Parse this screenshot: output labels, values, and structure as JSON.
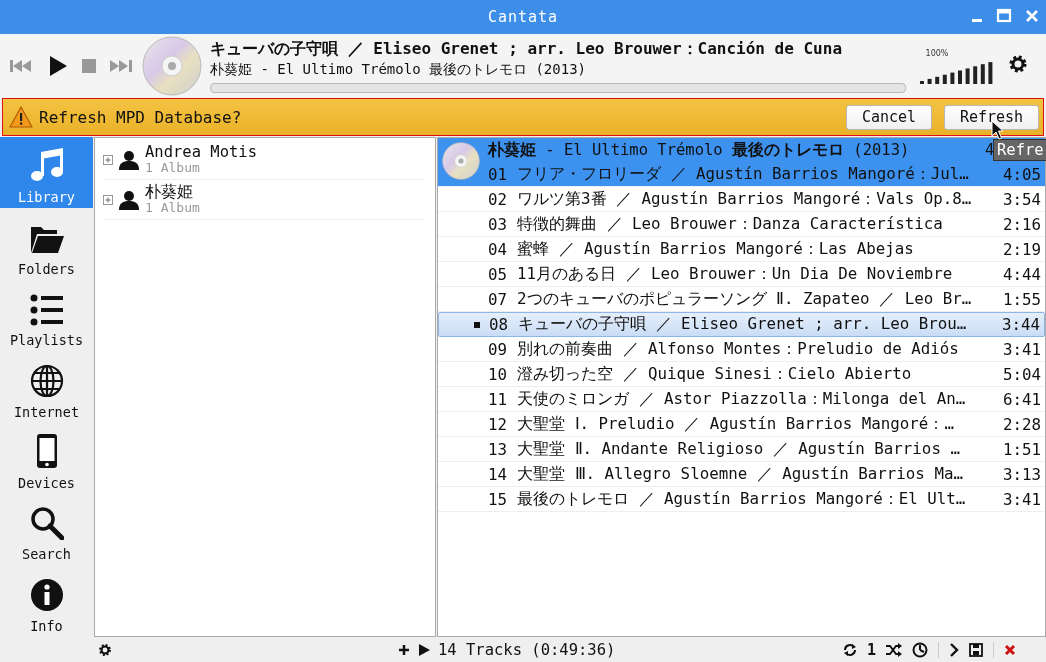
{
  "window": {
    "title": "Cantata"
  },
  "now_playing": {
    "title": "キューバの子守唄 ／ Eliseo Grenet ; arr. Leo Brouwer：Canción de Cuna",
    "subtitle": "朴葵姫 - El Ultimo Trémolo 最後のトレモロ (2013)",
    "progress": {
      "level": 0
    },
    "volume": {
      "label": "100%",
      "level": 1
    }
  },
  "message_bar": {
    "text": "Refresh MPD Database?",
    "buttons": [
      "Cancel",
      "Refresh"
    ]
  },
  "tooltip": "Refre",
  "sidebar": {
    "items": [
      {
        "label": "Library",
        "selected": true
      },
      {
        "label": "Folders",
        "selected": false
      },
      {
        "label": "Playlists",
        "selected": false
      },
      {
        "label": "Internet",
        "selected": false
      },
      {
        "label": "Devices",
        "selected": false
      },
      {
        "label": "Search",
        "selected": false
      },
      {
        "label": "Info",
        "selected": false
      }
    ]
  },
  "library": {
    "artists": [
      {
        "name": "Andrea Motis",
        "detail": "1 Album",
        "expanded": false
      },
      {
        "name": "朴葵姫",
        "detail": "1 Album",
        "expanded": false
      }
    ]
  },
  "play_queue": {
    "album_heading": "**朴葵姫** - El Ultimo Trémolo **最後のトレモロ** (2013)",
    "album_duration": "4",
    "tracks": [
      {
        "number": "01",
        "title": "フリア・フロリーダ ／ Agustín Barrios Mangoré：Jul…",
        "duration": "4:05",
        "selected": true,
        "current": false
      },
      {
        "number": "02",
        "title": "ワルツ第3番 ／ Agustín Barrios Mangoré：Vals Op.8…",
        "duration": "3:54",
        "selected": false,
        "current": false
      },
      {
        "number": "03",
        "title": "特徴的舞曲 ／ Leo Brouwer：Danza Característica",
        "duration": "2:16",
        "selected": false,
        "current": false
      },
      {
        "number": "04",
        "title": "蜜蜂 ／ Agustín Barrios Mangoré：Las Abejas",
        "duration": "2:19",
        "selected": false,
        "current": false
      },
      {
        "number": "05",
        "title": "11月のある日 ／ Leo Brouwer：Un Dia De Noviembre",
        "duration": "4:44",
        "selected": false,
        "current": false
      },
      {
        "number": "07",
        "title": "2つのキューバのポピュラーソング Ⅱ. Zapateo ／ Leo Br…",
        "duration": "1:55",
        "selected": false,
        "current": false
      },
      {
        "number": "08",
        "title": "キューバの子守唄 ／ Eliseo Grenet ; arr. Leo Brou…",
        "duration": "3:44",
        "selected": false,
        "current": true
      },
      {
        "number": "09",
        "title": "別れの前奏曲 ／ Alfonso Montes：Preludio de Adiós",
        "duration": "3:41",
        "selected": false,
        "current": false
      },
      {
        "number": "10",
        "title": "澄み切った空 ／ Quique Sinesi：Cielo Abierto",
        "duration": "5:04",
        "selected": false,
        "current": false
      },
      {
        "number": "11",
        "title": "天使のミロンガ ／ Astor Piazzolla：Milonga del An…",
        "duration": "6:41",
        "selected": false,
        "current": false
      },
      {
        "number": "12",
        "title": "大聖堂 Ⅰ. Preludio ／ Agustín Barrios Mangoré：…",
        "duration": "2:28",
        "selected": false,
        "current": false
      },
      {
        "number": "13",
        "title": "大聖堂 Ⅱ. Andante Religioso ／ Agustín Barrios …",
        "duration": "1:51",
        "selected": false,
        "current": false
      },
      {
        "number": "14",
        "title": "大聖堂 Ⅲ. Allegro Sloemne ／ Agustín Barrios Ma…",
        "duration": "3:13",
        "selected": false,
        "current": false
      },
      {
        "number": "15",
        "title": "最後のトレモロ ／ Agustín Barrios Mangoré：El Ult…",
        "duration": "3:41",
        "selected": false,
        "current": false
      }
    ]
  },
  "status_bar": {
    "summary": "14 Tracks (0:49:36)",
    "single_label": "1"
  }
}
